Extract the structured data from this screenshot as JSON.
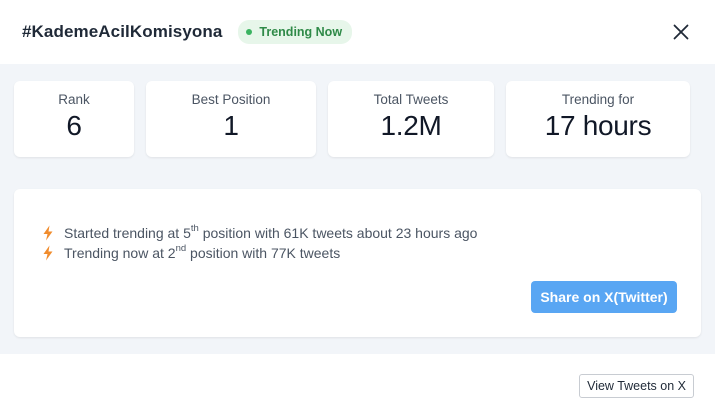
{
  "header": {
    "hashtag": "#KademeAcilKomisyona",
    "badge_label": "Trending Now",
    "close_icon": "close-icon"
  },
  "stats": {
    "rank": {
      "label": "Rank",
      "value": "6"
    },
    "best_position": {
      "label": "Best Position",
      "value": "1"
    },
    "total_tweets": {
      "label": "Total Tweets",
      "value": "1.2M"
    },
    "trending_for": {
      "label": "Trending for",
      "value": "17 hours"
    }
  },
  "history": {
    "line1": {
      "pre": "Started trending at 5",
      "sup": "th",
      "post": " position with 61K tweets about 23 hours ago"
    },
    "line2": {
      "pre": "Trending now at 2",
      "sup": "nd",
      "post": " position with 77K tweets"
    },
    "icon": "lightning-icon"
  },
  "actions": {
    "share_label": "Share on X(Twitter)",
    "view_label": "View Tweets on X"
  },
  "colors": {
    "accent": "#59a6f3",
    "badge_bg": "#e7f6ea",
    "badge_text": "#2f8a48",
    "bolt": "#f08c2e",
    "panel_bg": "#f2f5f9"
  }
}
